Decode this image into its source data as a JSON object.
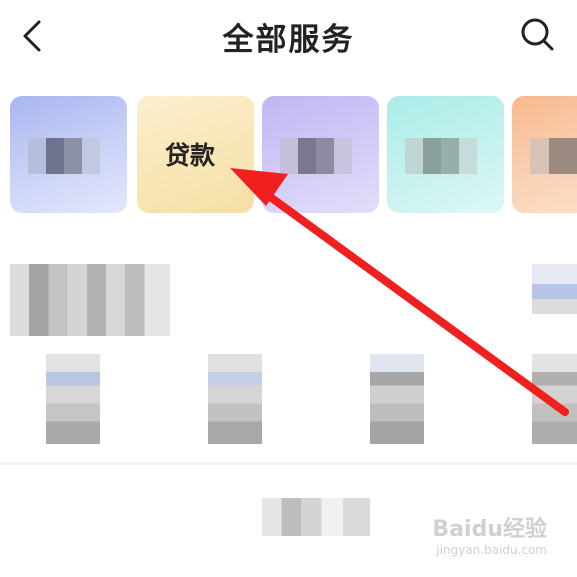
{
  "header": {
    "title": "全部服务"
  },
  "cards": [
    {
      "label": ""
    },
    {
      "label": "贷款"
    },
    {
      "label": ""
    },
    {
      "label": ""
    },
    {
      "label": ""
    }
  ],
  "watermark": {
    "brand": "Baidu经验",
    "url": "jingyan.baidu.com"
  },
  "colors": {
    "arrow": "#f0201e",
    "text": "#222222"
  }
}
